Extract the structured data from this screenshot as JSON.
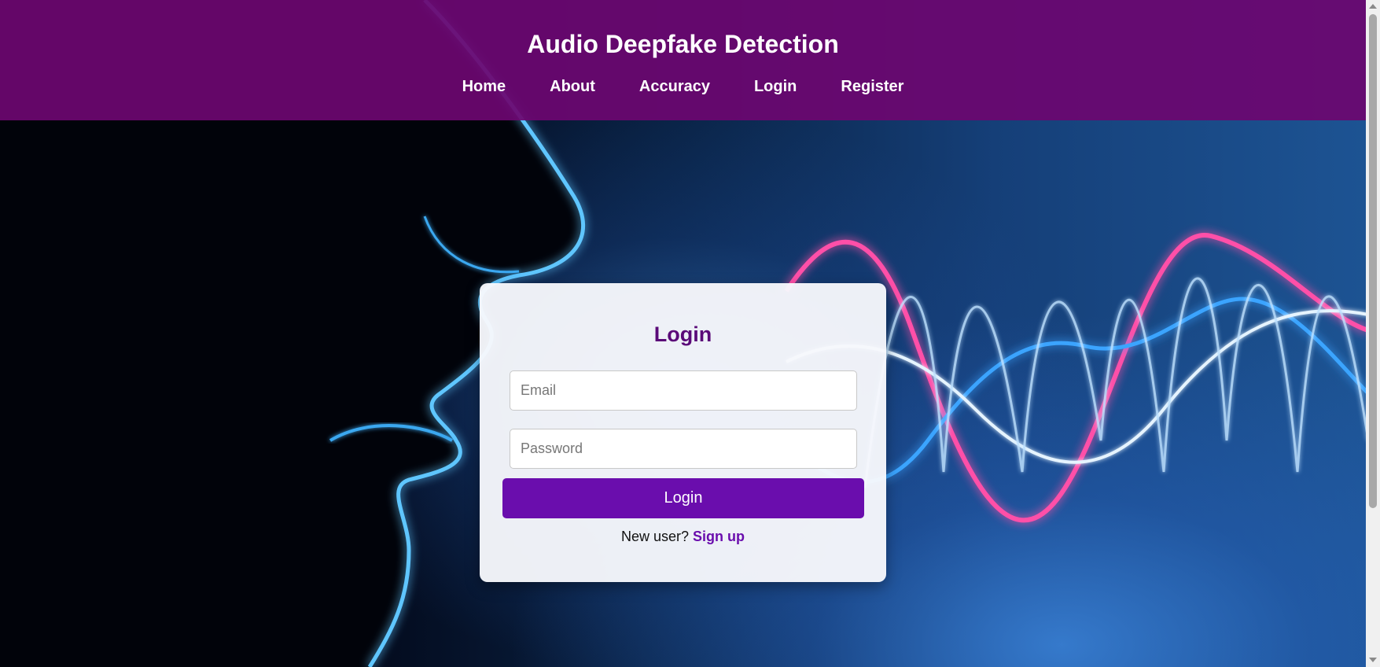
{
  "header": {
    "title": "Audio Deepfake Detection",
    "nav": [
      {
        "label": "Home"
      },
      {
        "label": "About"
      },
      {
        "label": "Accuracy"
      },
      {
        "label": "Login"
      },
      {
        "label": "Register"
      }
    ]
  },
  "login_form": {
    "title": "Login",
    "email_placeholder": "Email",
    "password_placeholder": "Password",
    "submit_label": "Login",
    "signup_prompt": "New user?",
    "signup_link": "Sign up"
  },
  "colors": {
    "header_bg": "#6c0670",
    "accent": "#6a0dad",
    "title_text": "#5a0a78"
  }
}
